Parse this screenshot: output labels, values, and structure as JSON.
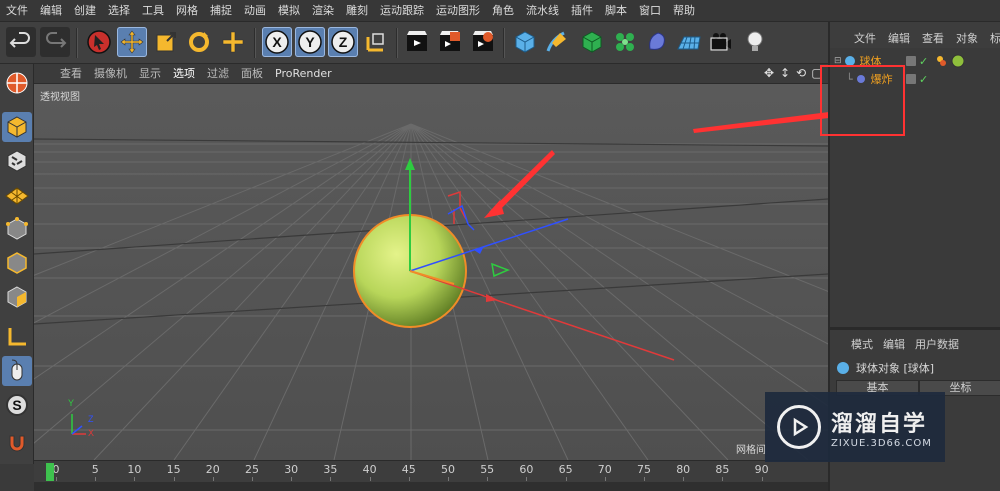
{
  "menu": [
    "文件",
    "编辑",
    "创建",
    "选择",
    "工具",
    "网格",
    "捕捉",
    "动画",
    "模拟",
    "渲染",
    "雕刻",
    "运动跟踪",
    "运动图形",
    "角色",
    "流水线",
    "插件",
    "脚本",
    "窗口",
    "帮助"
  ],
  "toolbar_icons": [
    "undo-icon",
    "redo-icon",
    "select-arrow-icon",
    "move-icon",
    "scale-icon",
    "rotate-icon",
    "move-plus-icon",
    "axis-x-icon",
    "axis-y-icon",
    "axis-z-icon",
    "coordinate-system-icon",
    "render-view-icon",
    "render-to-picture-viewer-icon",
    "render-settings-icon",
    "cube-object-icon",
    "pen-spline-icon",
    "subdivision-icon",
    "cloner-icon",
    "deformer-icon",
    "floor-icon",
    "camera-icon",
    "light-icon"
  ],
  "left_tools": [
    "make-editable-icon",
    "model-mode-icon",
    "texture-mode-icon",
    "workplane-icon",
    "points-mode-icon",
    "edges-mode-icon",
    "polygons-mode-icon",
    "axis-mode-icon",
    "mouse-tool-icon",
    "snap-icon",
    "magnet-icon"
  ],
  "viewport": {
    "menu": [
      "查看",
      "摄像机",
      "显示",
      "选项",
      "过滤",
      "面板",
      "ProRender"
    ],
    "active_menu": "选项",
    "label": "透视视图",
    "grid_label": "网格间"
  },
  "timeline": {
    "ticks": [
      "0",
      "5",
      "10",
      "15",
      "20",
      "25",
      "30",
      "35",
      "40",
      "45",
      "50",
      "55",
      "60",
      "65",
      "70",
      "75",
      "80",
      "85",
      "90"
    ],
    "current_frame": 0
  },
  "object_manager": {
    "menu": [
      "文件",
      "编辑",
      "查看",
      "对象",
      "标签"
    ],
    "objects": [
      {
        "name": "球体",
        "color": "#f0a020",
        "indent": 0
      },
      {
        "name": "爆炸",
        "color": "#f0a020",
        "indent": 1
      }
    ]
  },
  "attribute_manager": {
    "menu": [
      "模式",
      "编辑",
      "用户数据"
    ],
    "title": "球体对象 [球体]",
    "tabs": [
      "基本",
      "坐标"
    ]
  },
  "watermark": {
    "big": "溜溜自学",
    "small": "ZIXUE.3D66.COM"
  },
  "colors": {
    "sphere": "#b8d65a",
    "annotation_red": "#ff3232",
    "x_axis": "#e03a3a",
    "y_axis": "#2ecc40",
    "z_axis": "#3050ff",
    "timeline_playhead": "#3ec24e"
  }
}
